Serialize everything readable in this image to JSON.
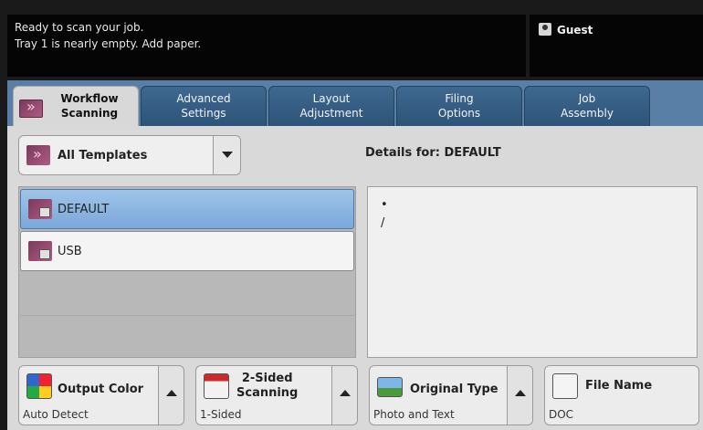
{
  "status": {
    "line1": "Ready to scan your job.",
    "line2": "Tray 1 is nearly empty. Add paper."
  },
  "user": {
    "label": "Guest",
    "icon": "user-icon"
  },
  "tabs": [
    {
      "line1": "Workflow",
      "line2": "Scanning",
      "active": true
    },
    {
      "line1": "Advanced",
      "line2": "Settings",
      "active": false
    },
    {
      "line1": "Layout",
      "line2": "Adjustment",
      "active": false
    },
    {
      "line1": "Filing",
      "line2": "Options",
      "active": false
    },
    {
      "line1": "Job",
      "line2": "Assembly",
      "active": false
    }
  ],
  "templates_dropdown": {
    "label": "All Templates"
  },
  "details": {
    "title": "Details for: DEFAULT",
    "line1": "•",
    "line2": "/"
  },
  "template_list": [
    {
      "label": "DEFAULT",
      "selected": true
    },
    {
      "label": "USB",
      "selected": false
    }
  ],
  "features": {
    "output_color": {
      "label": "Output Color",
      "value": "Auto Detect"
    },
    "two_sided": {
      "label_line1": "2-Sided",
      "label_line2": "Scanning",
      "value": "1-Sided"
    },
    "original_type": {
      "label": "Original Type",
      "value": "Photo and Text"
    },
    "file_name": {
      "label": "File Name",
      "value": "DOC"
    }
  },
  "colors": {
    "panel_blue": "#5a7fa6",
    "selected_row": "#8fb8e2",
    "status_bg": "#050505"
  }
}
